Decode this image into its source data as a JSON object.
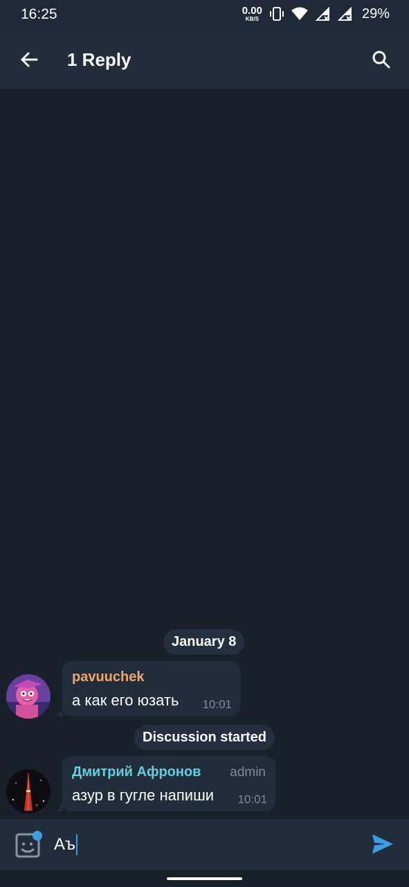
{
  "status_bar": {
    "time": "16:25",
    "speed_value": "0.00",
    "speed_unit": "KB/S",
    "battery": "29%",
    "icons": [
      "vibrate-icon",
      "wifi-icon",
      "signal-icon",
      "signal-icon"
    ]
  },
  "app_bar": {
    "title": "1 Reply",
    "back_icon": "back-arrow-icon",
    "search_icon": "search-icon"
  },
  "chat": {
    "date_label": "January 8",
    "service_message": "Discussion started",
    "messages": [
      {
        "sender": "pavuuchek",
        "sender_color": "#f2a56b",
        "text": "а как его юзать",
        "time": "10:01",
        "badge": ""
      },
      {
        "sender": "Дмитрий Афронов",
        "sender_color": "#5fd0e0",
        "text": "азур в гугле напиши",
        "time": "10:01",
        "badge": "admin"
      }
    ]
  },
  "input": {
    "value": "Аъ",
    "sticker_icon": "sticker-icon",
    "send_icon": "send-icon"
  },
  "colors": {
    "background": "#18202a",
    "bar": "#222d3b",
    "accent": "#3aa0e6"
  }
}
